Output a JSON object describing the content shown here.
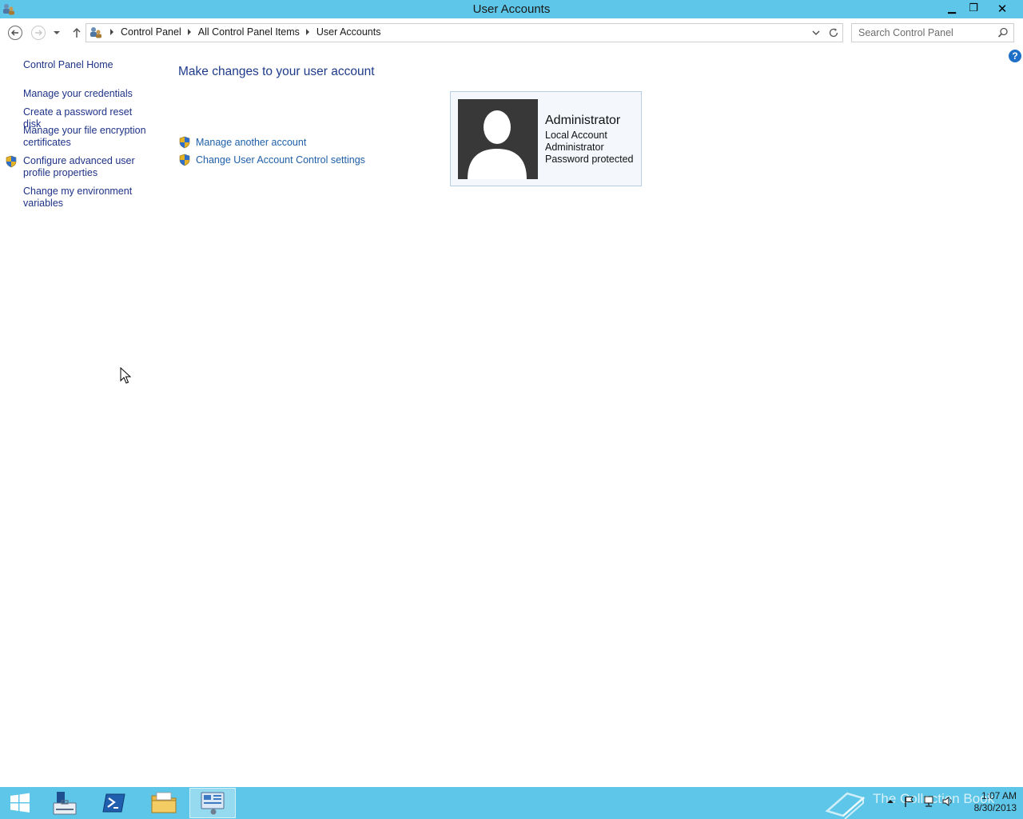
{
  "window": {
    "title": "User Accounts",
    "minimize_glyph": "▁",
    "restore_glyph": "❐",
    "close_glyph": "✕"
  },
  "address": {
    "crumbs": [
      "Control Panel",
      "All Control Panel Items",
      "User Accounts"
    ]
  },
  "search": {
    "placeholder": "Search Control Panel"
  },
  "help_glyph": "?",
  "sidebar": {
    "home": "Control Panel Home",
    "items": [
      {
        "label": "Manage your credentials",
        "shield": false
      },
      {
        "label": "Create a password reset disk",
        "shield": false
      },
      {
        "label": "Manage your file encryption certificates",
        "shield": false
      },
      {
        "label": "Configure advanced user profile properties",
        "shield": true
      },
      {
        "label": "Change my environment variables",
        "shield": false
      }
    ]
  },
  "main": {
    "heading": "Make changes to your user account",
    "tasks": [
      {
        "label": "Manage another account",
        "shield": true
      },
      {
        "label": "Change User Account Control settings",
        "shield": true
      }
    ]
  },
  "account": {
    "name": "Administrator",
    "type": "Local Account",
    "group": "Administrator",
    "status": "Password protected"
  },
  "taskbar": {
    "items": [
      "start-icon",
      "server-manager-icon",
      "powershell-icon",
      "file-explorer-icon",
      "control-panel-icon"
    ],
    "active_index": 4,
    "watermark": "The Collection Book",
    "time": "1:07 AM",
    "date": "8/30/2013"
  },
  "colors": {
    "chrome": "#5ec6e8",
    "link": "#1e3287",
    "heading": "#1e3b8a",
    "card_border": "#b7cde6"
  }
}
